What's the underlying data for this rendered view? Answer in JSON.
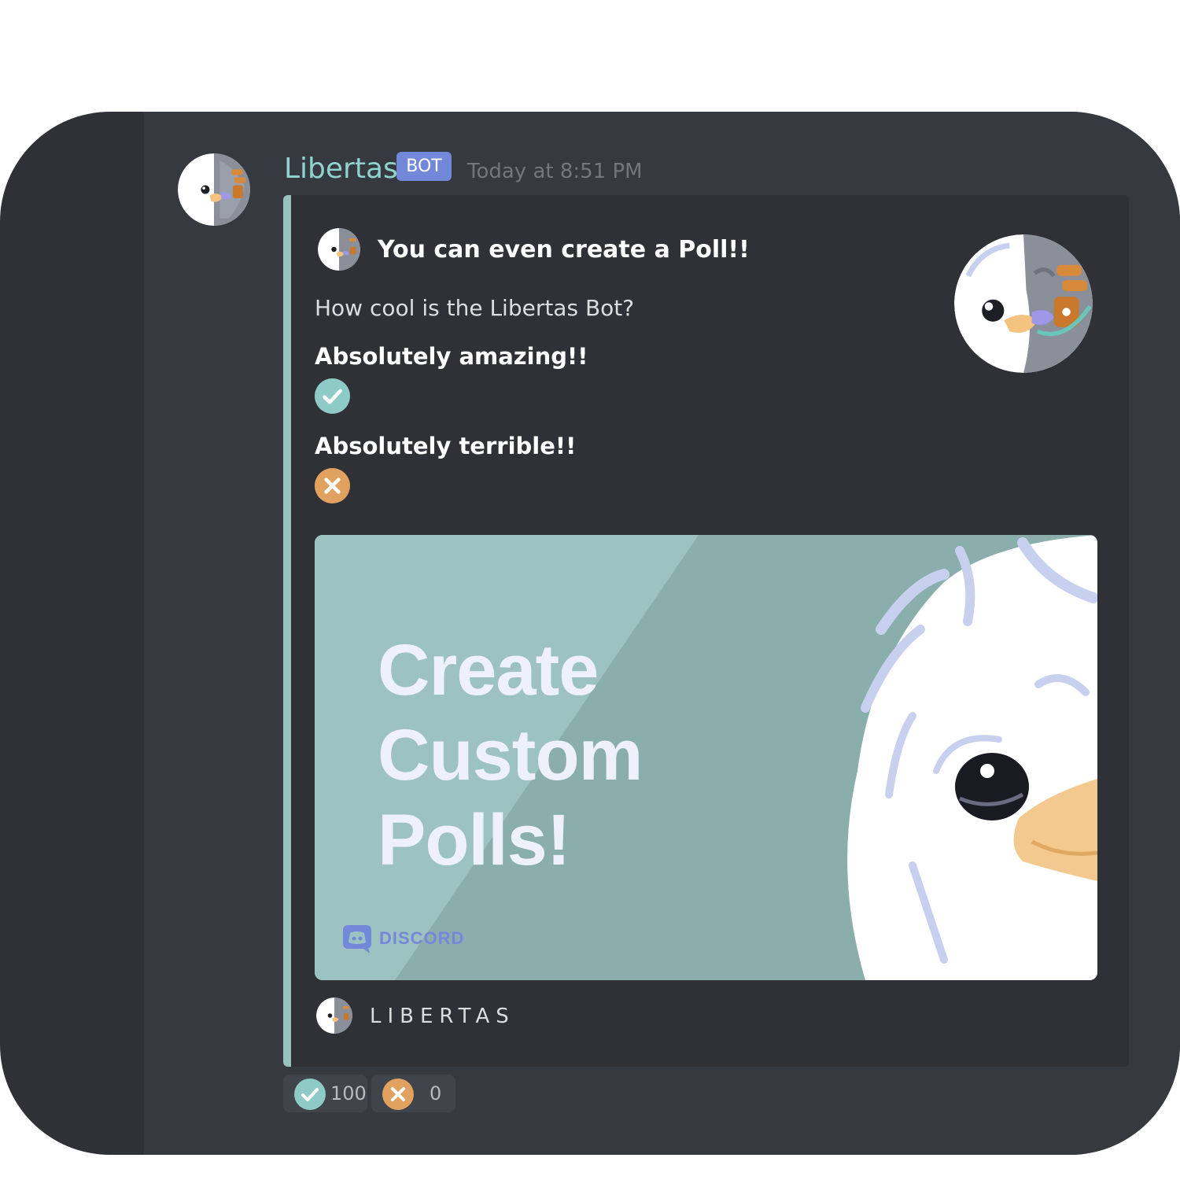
{
  "message": {
    "author": "Libertas",
    "bot_tag": "BOT",
    "timestamp": "Today at 8:51 PM"
  },
  "embed": {
    "accent_color": "#99c2bf",
    "title": "You can even create a Poll!!",
    "description": "How cool is the Libertas Bot?",
    "fields": [
      {
        "name": "Absolutely amazing!!",
        "icon": "check-icon",
        "color": "#8fcbc6"
      },
      {
        "name": "Absolutely terrible!!",
        "icon": "x-icon",
        "color": "#e1a25f"
      }
    ],
    "image": {
      "lines": [
        "Create",
        "Custom",
        "Polls!"
      ],
      "brand": "DISCORD"
    },
    "footer": "LIBERTAS"
  },
  "reactions": [
    {
      "icon": "check-icon",
      "count": "100"
    },
    {
      "icon": "x-icon",
      "count": "0"
    }
  ]
}
